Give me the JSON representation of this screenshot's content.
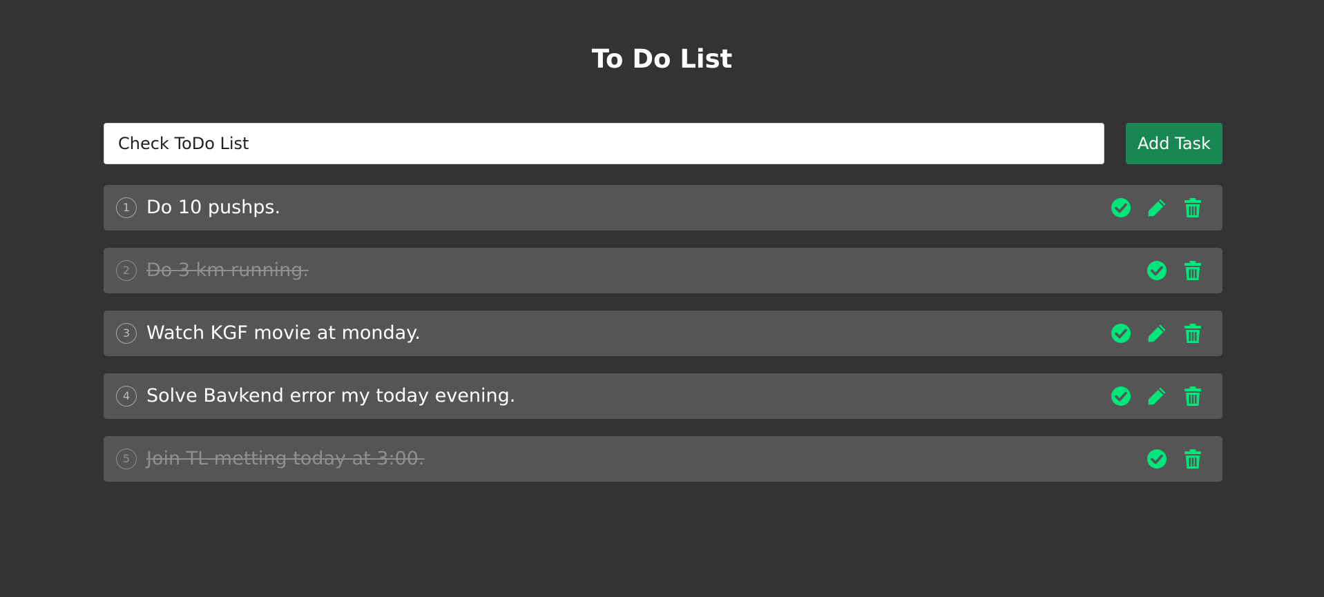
{
  "header": {
    "title": "To Do List"
  },
  "input": {
    "value": "Check ToDo List",
    "placeholder": ""
  },
  "add_button": {
    "label": "Add Task"
  },
  "accent_color": "#00e67a",
  "tasks": [
    {
      "number": "1",
      "text": "Do 10 pushps.",
      "completed": false,
      "actions": [
        "check-circle-icon",
        "pencil-icon",
        "trash-icon"
      ]
    },
    {
      "number": "2",
      "text": "Do 3 km running.",
      "completed": true,
      "actions": [
        "check-circle-icon",
        "trash-icon"
      ]
    },
    {
      "number": "3",
      "text": "Watch KGF movie at monday.",
      "completed": false,
      "actions": [
        "check-circle-icon",
        "pencil-icon",
        "trash-icon"
      ]
    },
    {
      "number": "4",
      "text": "Solve Bavkend error my today evening.",
      "completed": false,
      "actions": [
        "check-circle-icon",
        "pencil-icon",
        "trash-icon"
      ]
    },
    {
      "number": "5",
      "text": "Join TL metting today at 3:00.",
      "completed": true,
      "actions": [
        "check-circle-icon",
        "trash-icon"
      ]
    }
  ]
}
